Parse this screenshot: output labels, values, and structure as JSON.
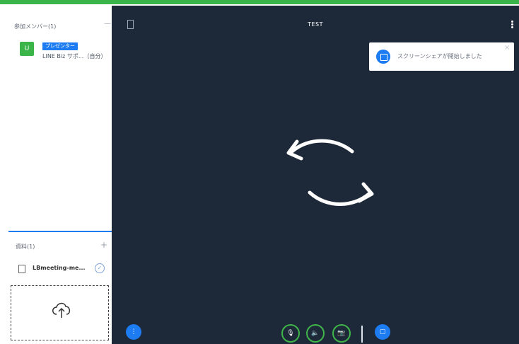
{
  "sidebar": {
    "members_header": "参加メンバー(1)",
    "members_minus": "—",
    "member": {
      "avatar_letter": "U",
      "role": "プレゼンター",
      "name": "LINE Biz サポ...（自分）"
    },
    "materials_header": "資料(1)",
    "materials_plus": "+",
    "files": [
      {
        "name": "LBmeeting-me...",
        "check_icon": "check-icon"
      }
    ],
    "upload_icon": "cloud-upload-icon"
  },
  "main": {
    "title": "TEST",
    "toast": {
      "text": "スクリーンシェアが開始しました",
      "close": "×"
    },
    "controls": {
      "menu": "⋮",
      "mic": "🎙",
      "speaker": "🔈",
      "camera": "📷",
      "screen": "▢"
    }
  },
  "colors": {
    "accent_green": "#39b54a",
    "accent_blue": "#1d7cf2",
    "stage_bg": "#1d2938"
  }
}
